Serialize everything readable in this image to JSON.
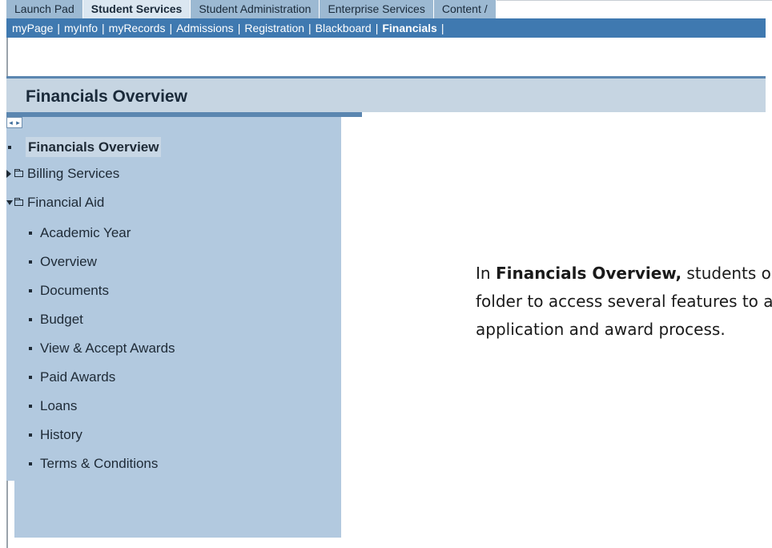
{
  "tabs": [
    "Launch Pad",
    "Student Services",
    "Student Administration",
    "Enterprise Services",
    "Content /"
  ],
  "active_tab_index": 1,
  "subnav": [
    "myPage",
    "myInfo",
    "myRecords",
    "Admissions",
    "Registration",
    "Blackboard",
    "Financials"
  ],
  "active_subnav": "Financials",
  "page_header": "Financials Overview",
  "sidebar": {
    "collapse_controls": [
      "◂",
      "▸"
    ],
    "items": [
      {
        "label": "Financials Overview",
        "type": "current"
      },
      {
        "label": "Billing Services",
        "type": "folder-collapsed"
      },
      {
        "label": "Financial Aid",
        "type": "folder-expanded"
      },
      {
        "label": "Academic Year",
        "type": "child"
      },
      {
        "label": "Overview",
        "type": "child"
      },
      {
        "label": "Documents",
        "type": "child"
      },
      {
        "label": "Budget",
        "type": "child"
      },
      {
        "label": "View & Accept Awards",
        "type": "child"
      },
      {
        "label": "Paid Awards",
        "type": "child"
      },
      {
        "label": "Loans",
        "type": "child"
      },
      {
        "label": "History",
        "type": "child"
      },
      {
        "label": "Terms & Conditions",
        "type": "child"
      }
    ]
  },
  "description": {
    "prefix": "In ",
    "bold": "Financials Overview,",
    "line1_rest": " students open t",
    "line2": "folder to access several features to assis",
    "line3": "application and award process."
  },
  "colors": {
    "tab_bg": "#9cb9d2",
    "tab_active_bg": "#dbe7f1",
    "subnav_bg": "#3f79b0",
    "header_bg": "#c6d5e2",
    "sidebar_bg": "#b2c9df"
  }
}
